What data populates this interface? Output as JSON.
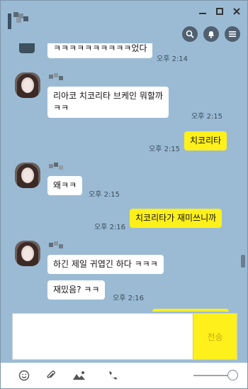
{
  "window": {
    "minimize_icon": "minimize-icon",
    "maximize_icon": "maximize-icon",
    "close_icon": "close-icon"
  },
  "toolbar": {
    "icons": [
      "search-icon",
      "bell-icon",
      "menu-icon"
    ]
  },
  "messages": [
    {
      "side": "them",
      "text": "ㅋㅋㅋㅋㅋㅋㅋㅋㅋㅋ었다",
      "time": "오후 2:14"
    },
    {
      "side": "them",
      "text1": "리아코 치코리타 브케인 뭐할까",
      "text2": "ㅋㅋ",
      "time": "오후 2:15"
    },
    {
      "side": "me",
      "text": "치코리타",
      "time": "오후 2:15"
    },
    {
      "side": "them",
      "text": "왜ㅋㅋ",
      "time": "오후 2:15"
    },
    {
      "side": "me",
      "text": "치코리타가 재미쓰니까",
      "time": "오후 2:16"
    },
    {
      "side": "them",
      "text": "하긴 제일 귀엽긴 하다 ㅋㅋㅋ"
    },
    {
      "side": "them",
      "text": "재밌음? ㅋㅋ",
      "time": "오후 2:16"
    }
  ],
  "input": {
    "value": "",
    "send_label": "전송"
  },
  "bottom_icons": [
    "emoji-icon",
    "attach-icon",
    "photo-icon",
    "phone-icon"
  ],
  "colors": {
    "background": "#9bbbd4",
    "my_bubble": "#fef01b",
    "their_bubble": "#ffffff"
  }
}
